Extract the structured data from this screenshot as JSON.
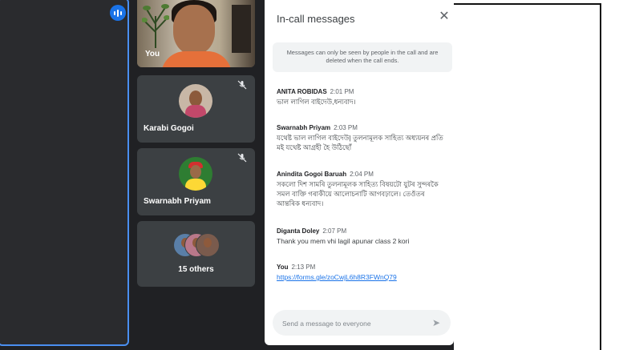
{
  "self_tile": {
    "label": "You"
  },
  "participants": [
    {
      "name": "Karabi Gogoi",
      "muted": true
    },
    {
      "name": "Swarnabh Priyam",
      "muted": true
    }
  ],
  "others_tile": {
    "label": "15 others"
  },
  "chat": {
    "title": "In-call messages",
    "notice": "Messages can only be seen by people in the call and are deleted when the call ends.",
    "messages": [
      {
        "sender": "ANITA ROBIDAS",
        "time": "2:01 PM",
        "text": "ভাল লাগিল বাইদেউ,ধন্যবাদ।"
      },
      {
        "sender": "Swarnabh Priyam",
        "time": "2:03 PM",
        "text": "যথেষ্ট ভাল লাগিল বাইদেউ| তুলনামূলক সাহিত্য অধ্যয়নৰ প্ৰতি মই যথেষ্ট আগ্ৰহী হৈ উঠিছোঁ"
      },
      {
        "sender": "Anindita Gogoi Baruah",
        "time": "2:04 PM",
        "text": "সকলো দিশ সামৰি তুলনামূলক সাহিত্য বিষয়টো যুটৰ সুন্দৰকৈ সমল বাক্তি গৰাকীয়ে আলোচনাটি আগবঢ়ালে। তেওঁতৰ আন্তৰিক ধন্যবাদ।"
      },
      {
        "sender": "Diganta Doley",
        "time": "2:07 PM",
        "text": "Thank you mem vhi lagil apunar class 2 kori"
      },
      {
        "sender": "You",
        "time": "2:13 PM",
        "text": "https://forms.gle/zoCwjL6h8R3FWnQ79",
        "is_link": true
      }
    ],
    "input_placeholder": "Send a message to everyone"
  },
  "colors": {
    "background": "#202124",
    "tile": "#3c4043",
    "accent": "#1a73e8",
    "panel": "#ffffff"
  },
  "icons": [
    "speaking-indicator-icon",
    "mic-off-icon",
    "close-icon",
    "send-icon"
  ]
}
